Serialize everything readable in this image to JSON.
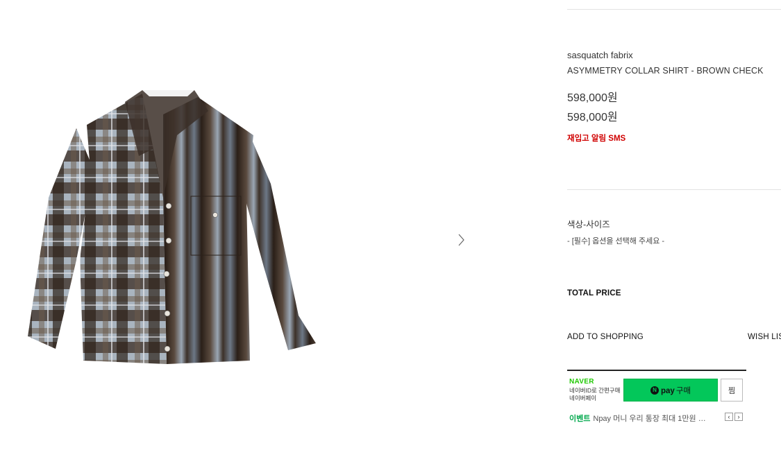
{
  "product": {
    "brand": "sasquatch fabrix",
    "name": "ASYMMETRY COLLAR SHIRT - BROWN CHECK",
    "price": "598,000원",
    "sale_price": "598,000원",
    "restock_label": "재입고 알림 SMS"
  },
  "options": {
    "title": "색상-사이즈",
    "select_placeholder": "- [필수] 옵션을 선택해 주세요 -"
  },
  "total": {
    "label": "TOTAL PRICE"
  },
  "actions": {
    "add_to_cart": "ADD TO SHOPPING",
    "wish_list": "WISH LIST"
  },
  "npay": {
    "naver_logo": "NAVER",
    "desc_line1": "네이버ID로 간편구매",
    "desc_line2": "네이버페이",
    "n_mark": "N",
    "button_pay": "pay",
    "button_label": "구매",
    "zzim_label": "찜",
    "event_label": "이벤트",
    "event_text": "Npay 머니 우리 통장 최대 1만원 …",
    "prev": "‹",
    "next": "›"
  },
  "colors": {
    "restock": "#d00000",
    "naver_green": "#03c75a",
    "event_green": "#03a94e"
  },
  "icons": {
    "gallery_next": "chevron-right-icon"
  }
}
